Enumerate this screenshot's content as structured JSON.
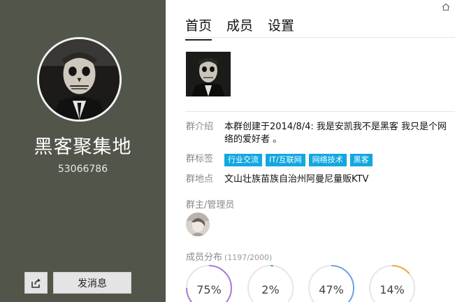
{
  "group": {
    "name": "黑客聚集地",
    "id": "53066786"
  },
  "actions": {
    "share_icon": "share-icon",
    "send_message_label": "发消息"
  },
  "tabs": [
    {
      "label": "首页",
      "active": true
    },
    {
      "label": "成员",
      "active": false
    },
    {
      "label": "设置",
      "active": false
    }
  ],
  "info": {
    "intro_label": "群介绍",
    "intro_text": "本群创建于2014/8/4:  我是安凯我不是黑客 我只是个网络的爱好者 。",
    "tags_label": "群标签",
    "tags": [
      "行业交流",
      "IT/互联网",
      "网络技术",
      "黑客"
    ],
    "location_label": "群地点",
    "location_text": "文山壮族苗族自治州阿曼尼量贩KTV"
  },
  "admins": {
    "label": "群主/管理员"
  },
  "distribution": {
    "label": "成员分布",
    "count": "(1197/2000)",
    "items": [
      {
        "text": "75%",
        "value": 0.75,
        "color": "#a77ad8"
      },
      {
        "text": "2%",
        "value": 0.02,
        "color": "#41c387"
      },
      {
        "text": "47%",
        "value": 0.47,
        "color": "#6ea1e8"
      },
      {
        "text": "14%",
        "value": 0.14,
        "color": "#f0a93b"
      }
    ]
  },
  "colors": {
    "sidebar_bg": "#525549",
    "tag_bg": "#12a7e0",
    "ring_track": "#e6e6e6"
  }
}
